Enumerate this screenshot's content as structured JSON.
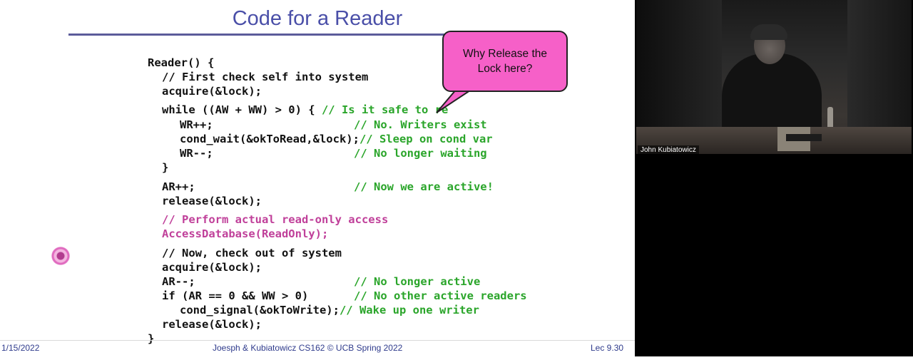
{
  "slide": {
    "title": "Code for a Reader",
    "callout": {
      "line1": "Why Release the",
      "line2": "Lock here?"
    },
    "code_lines": [
      {
        "segments": [
          {
            "text": "Reader() {",
            "color": "black"
          }
        ]
      },
      {
        "segments": [
          {
            "text": "// First check self into system",
            "color": "black"
          }
        ]
      },
      {
        "segments": [
          {
            "text": "acquire(&lock);",
            "color": "black"
          }
        ]
      },
      {
        "segments": [
          {
            "text": "while ((AW + WW) > 0) { ",
            "color": "black"
          },
          {
            "text": "// Is it safe to re",
            "color": "green"
          }
        ]
      },
      {
        "segments": [
          {
            "text": "WR++;",
            "color": "black"
          },
          {
            "text": "// No. Writers exist",
            "color": "green"
          }
        ]
      },
      {
        "segments": [
          {
            "text": "cond_wait(&okToRead,&lock);",
            "color": "black"
          },
          {
            "text": "// Sleep on cond var",
            "color": "green"
          }
        ]
      },
      {
        "segments": [
          {
            "text": "WR--;",
            "color": "black"
          },
          {
            "text": "// No longer waiting",
            "color": "green"
          }
        ]
      },
      {
        "segments": [
          {
            "text": "}",
            "color": "black"
          }
        ]
      },
      {
        "segments": [
          {
            "text": "AR++;",
            "color": "black"
          },
          {
            "text": "// Now we are active!",
            "color": "green"
          }
        ]
      },
      {
        "segments": [
          {
            "text": "release(&lock);",
            "color": "black"
          }
        ]
      },
      {
        "segments": [
          {
            "text": "// Perform actual read-only access",
            "color": "magenta"
          }
        ]
      },
      {
        "segments": [
          {
            "text": "AccessDatabase(ReadOnly);",
            "color": "magenta"
          }
        ]
      },
      {
        "segments": [
          {
            "text": "// Now, check out of system",
            "color": "black"
          }
        ]
      },
      {
        "segments": [
          {
            "text": "acquire(&lock);",
            "color": "black"
          }
        ]
      },
      {
        "segments": [
          {
            "text": "AR--;",
            "color": "black"
          },
          {
            "text": "// No longer active",
            "color": "green"
          }
        ]
      },
      {
        "segments": [
          {
            "text": "if (AR == 0 && WW > 0)",
            "color": "black"
          },
          {
            "text": "// No other active readers",
            "color": "green"
          }
        ]
      },
      {
        "segments": [
          {
            "text": "cond_signal(&okToWrite);",
            "color": "black"
          },
          {
            "text": "// Wake up one writer",
            "color": "green"
          }
        ]
      },
      {
        "segments": [
          {
            "text": "release(&lock);",
            "color": "black"
          }
        ]
      },
      {
        "segments": [
          {
            "text": "}",
            "color": "black"
          }
        ]
      }
    ],
    "footer": {
      "date": "1/15/2022",
      "course": "Joesph & Kubiatowicz CS162 © UCB Spring 2022",
      "lecture": "Lec 9.30"
    },
    "pointer_icon": "laser-pointer-icon"
  },
  "video": {
    "speaker_name": "John Kubiatowicz"
  },
  "colors": {
    "title": "#4a4fa8",
    "code_black": "#111111",
    "code_green": "#2aa52a",
    "code_magenta": "#c0409a",
    "callout_fill": "#f660c8",
    "footer_text": "#2f3b8c"
  }
}
